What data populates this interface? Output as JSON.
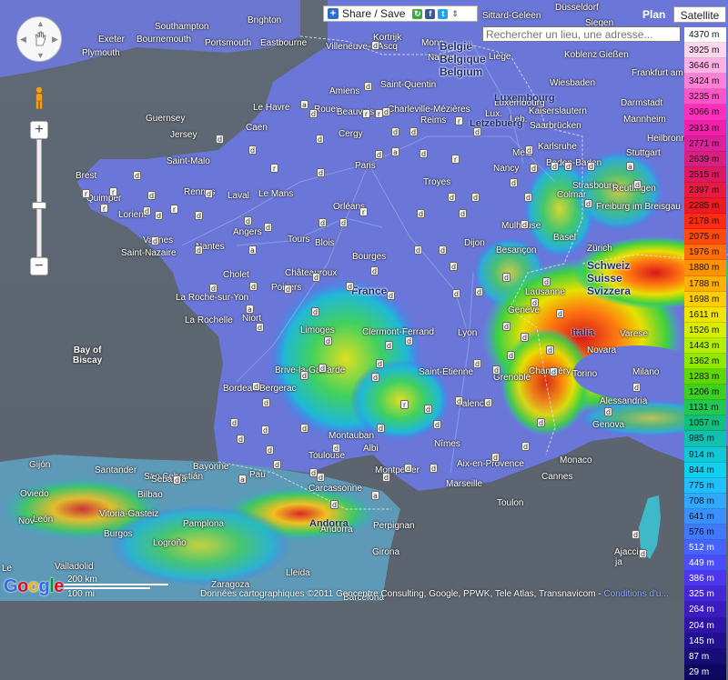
{
  "share": {
    "label": "Share / Save",
    "plus_icon": "plus-icon",
    "icons": [
      "refresh-icon",
      "facebook-icon",
      "twitter-icon"
    ],
    "chevron": "⇕"
  },
  "maptype": {
    "plan": "Plan",
    "satellite": "Satellite"
  },
  "search": {
    "placeholder": "Rechercher un lieu, une adresse..."
  },
  "zoom": {
    "in": "+",
    "out": "−"
  },
  "legend": [
    "4370 m",
    "3925 m",
    "3646 m",
    "3424 m",
    "3235 m",
    "3066 m",
    "2913 m",
    "2771 m",
    "2639 m",
    "2515 m",
    "2397 m",
    "2285 m",
    "2178 m",
    "2075 m",
    "1976 m",
    "1880 m",
    "1788 m",
    "1698 m",
    "1611 m",
    "1526 m",
    "1443 m",
    "1362 m",
    "1283 m",
    "1206 m",
    "1131 m",
    "1057 m",
    "985 m",
    "914 m",
    "844 m",
    "775 m",
    "708 m",
    "641 m",
    "576 m",
    "512 m",
    "449 m",
    "386 m",
    "325 m",
    "264 m",
    "204 m",
    "145 m",
    "87 m",
    "29 m"
  ],
  "legend_colors": [
    "#ffffff",
    "#ffd6ee",
    "#ffb0e4",
    "#ff80d6",
    "#ff55c8",
    "#ff2ebc",
    "#f020aa",
    "#e0209a",
    "#d82080",
    "#e01860",
    "#e81a40",
    "#ee1a22",
    "#ff2a12",
    "#ff4a0c",
    "#ff6e08",
    "#ff9200",
    "#ffb000",
    "#ffce00",
    "#f0e400",
    "#d8ee00",
    "#b4ee00",
    "#8ee800",
    "#5ed800",
    "#3cd020",
    "#20c850",
    "#10c080",
    "#10c0b0",
    "#10c8d8",
    "#10d0f0",
    "#20c0ff",
    "#30a8ff",
    "#3a90ff",
    "#4078ff",
    "#4862ff",
    "#4c4cff",
    "#4c36ee",
    "#4428d8",
    "#3a1cc0",
    "#2e14a8",
    "#221090",
    "#180c78",
    "#100860"
  ],
  "labels": {
    "cities": [
      {
        "t": "Brighton"
      },
      {
        "t": "Southampton"
      },
      {
        "t": "Bournemouth"
      },
      {
        "t": "Portsmouth"
      },
      {
        "t": "Eastbourne"
      },
      {
        "t": "Exeter"
      },
      {
        "t": "Plymouth"
      },
      {
        "t": "Guernsey"
      },
      {
        "t": "Jersey"
      },
      {
        "t": "Caen"
      },
      {
        "t": "Le Havre"
      },
      {
        "t": "Rouen"
      },
      {
        "t": "Amiens"
      },
      {
        "t": "Beauvais"
      },
      {
        "t": "Saint-Quentin"
      },
      {
        "t": "Charleville-Mézières"
      },
      {
        "t": "Reims"
      },
      {
        "t": "Cergy"
      },
      {
        "t": "Paris"
      },
      {
        "t": "Saint-Malo"
      },
      {
        "t": "Brest"
      },
      {
        "t": "Quimper"
      },
      {
        "t": "Lorient"
      },
      {
        "t": "Vannes"
      },
      {
        "t": "Rennes"
      },
      {
        "t": "Laval"
      },
      {
        "t": "Le Mans"
      },
      {
        "t": "Orléans"
      },
      {
        "t": "Tours"
      },
      {
        "t": "Blois"
      },
      {
        "t": "Angers"
      },
      {
        "t": "Nantes"
      },
      {
        "t": "Saint-Nazaire"
      },
      {
        "t": "Cholet"
      },
      {
        "t": "Bourges"
      },
      {
        "t": "Troyes"
      },
      {
        "t": "Dijon"
      },
      {
        "t": "Châteauroux"
      },
      {
        "t": "Poitiers"
      },
      {
        "t": "La Roche-sur-Yon"
      },
      {
        "t": "Niort"
      },
      {
        "t": "La Rochelle"
      },
      {
        "t": "Limoges"
      },
      {
        "t": "Clermont-Ferrand"
      },
      {
        "t": "Lyon"
      },
      {
        "t": "Saint-Étienne"
      },
      {
        "t": "Brive-la-Gaillarde"
      },
      {
        "t": "Bordeaux"
      },
      {
        "t": "Bergerac"
      },
      {
        "t": "Montauban"
      },
      {
        "t": "Albi"
      },
      {
        "t": "Toulouse"
      },
      {
        "t": "Pau"
      },
      {
        "t": "Bayonne"
      },
      {
        "t": "Carcassonne"
      },
      {
        "t": "Perpignan"
      },
      {
        "t": "Montpellier"
      },
      {
        "t": "Nîmes"
      },
      {
        "t": "Marseille"
      },
      {
        "t": "Aix-en-Provence"
      },
      {
        "t": "Toulon"
      },
      {
        "t": "Cannes"
      },
      {
        "t": "Monaco"
      },
      {
        "t": "Genova"
      },
      {
        "t": "Alessandria"
      },
      {
        "t": "Torino"
      },
      {
        "t": "Milano"
      },
      {
        "t": "Novara"
      },
      {
        "t": "Varese"
      },
      {
        "t": "Genève"
      },
      {
        "t": "Lausanne"
      },
      {
        "t": "Grenoble"
      },
      {
        "t": "Valence"
      },
      {
        "t": "Chambéry"
      },
      {
        "t": "Besançon"
      },
      {
        "t": "Mulhouse"
      },
      {
        "t": "Basel"
      },
      {
        "t": "Zürich"
      },
      {
        "t": "Colmar"
      },
      {
        "t": "Freiburg im Breisgau"
      },
      {
        "t": "Strasbourg"
      },
      {
        "t": "Nancy"
      },
      {
        "t": "Metz"
      },
      {
        "t": "Luxembourg"
      },
      {
        "t": "Saarbrücken"
      },
      {
        "t": "Kaiserslautern"
      },
      {
        "t": "Karlsruhe"
      },
      {
        "t": "Stuttgart"
      },
      {
        "t": "Reutlingen"
      },
      {
        "t": "Heilbronn"
      },
      {
        "t": "Mannheim"
      },
      {
        "t": "Darmstadt"
      },
      {
        "t": "Frankfurt am Main"
      },
      {
        "t": "Wiesbaden"
      },
      {
        "t": "Koblenz"
      },
      {
        "t": "Gießen"
      },
      {
        "t": "Siegen"
      },
      {
        "t": "Düsseldorf"
      },
      {
        "t": "Sittard-Geleen"
      },
      {
        "t": "Liège"
      },
      {
        "t": "Namur"
      },
      {
        "t": "Mons"
      },
      {
        "t": "Kortrijk"
      },
      {
        "t": "Villeneuve-d'Ascq"
      },
      {
        "t": "Baden-Baden"
      },
      {
        "t": "Gijón"
      },
      {
        "t": "Oviedo"
      },
      {
        "t": "Santander"
      },
      {
        "t": "San Sebastián"
      },
      {
        "t": "Bilbao"
      },
      {
        "t": "Vitoria-Gasteiz"
      },
      {
        "t": "Pamplona"
      },
      {
        "t": "León"
      },
      {
        "t": "Burgos"
      },
      {
        "t": "Logroño"
      },
      {
        "t": "Valladolid"
      },
      {
        "t": "Zaragoza"
      },
      {
        "t": "Lleida"
      },
      {
        "t": "Girona"
      },
      {
        "t": "Andorra"
      },
      {
        "t": "Ajaccio"
      },
      {
        "t": "Sebastià"
      },
      {
        "t": "Lux."
      },
      {
        "t": "Barcelona"
      },
      {
        "t": "Leb."
      },
      {
        "t": "Nov"
      },
      {
        "t": "Le"
      },
      {
        "t": "ja"
      }
    ],
    "countries": [
      {
        "t": "France"
      },
      {
        "t": "België\nBelgique\nBelgium"
      },
      {
        "t": "Luxembourg"
      },
      {
        "t": "Letzebuerg"
      },
      {
        "t": "Schweiz\nSuisse\nSvizzera"
      },
      {
        "t": "Italia"
      },
      {
        "t": "Andorra"
      }
    ],
    "water": [
      {
        "t": "Bay of\nBiscay"
      }
    ]
  },
  "footer": {
    "logo": "Google",
    "scale_km": "200 km",
    "scale_mi": "100 mi",
    "credits": "Données cartographiques ©2011 Geocentre Consulting, Google, PPWK, Tele Atlas, Transnavicom -",
    "terms": "Conditions d'u..."
  },
  "icons": [
    "pan-control-icon",
    "pegman-icon",
    "hand-icon",
    "chevron-up-icon",
    "chevron-down-icon",
    "chevron-left-icon",
    "chevron-right-icon"
  ]
}
